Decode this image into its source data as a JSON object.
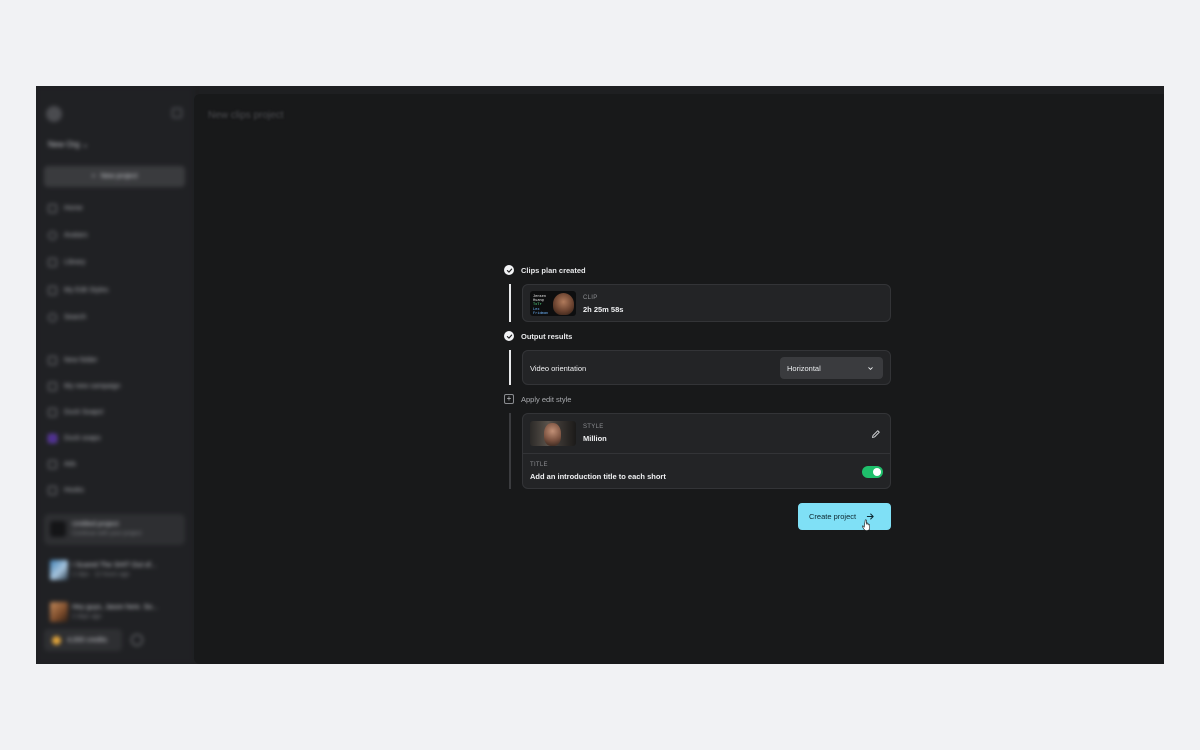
{
  "sidebar": {
    "org_name": "New Org",
    "new_project_label": "New project",
    "nav": [
      {
        "label": "Home",
        "icon": "home-icon"
      },
      {
        "label": "Avatars",
        "icon": "avatar-icon"
      },
      {
        "label": "Library",
        "icon": "library-icon"
      },
      {
        "label": "My Edit Styles",
        "icon": "edit-styles-icon"
      },
      {
        "label": "Search",
        "icon": "search-icon"
      }
    ],
    "folders": [
      {
        "label": "New folder",
        "icon": "folder-icon"
      },
      {
        "label": "My new campaign",
        "icon": "campaign-icon"
      },
      {
        "label": "Duck Soaps!",
        "icon": "campaign-icon"
      },
      {
        "label": "Duck soaps",
        "icon": "campaign-icon"
      },
      {
        "label": "Ads",
        "icon": "folder-icon"
      },
      {
        "label": "Hooks",
        "icon": "folder-icon"
      }
    ],
    "current_project": {
      "title": "Untitled project",
      "subtitle": "Continue with your project"
    },
    "recent_videos": [
      {
        "title": "I Scared The SHIT Out of...",
        "meta": "2 clips · 12 hours ago"
      },
      {
        "title": "Hey guys, Jason here. So...",
        "meta": "2 days ago"
      }
    ],
    "credits": "4,000 credits"
  },
  "main": {
    "header_title": "New clips project",
    "steps": {
      "clips_plan": {
        "title": "Clips plan created",
        "clip_label": "CLIP",
        "clip_duration": "2h 25m 58s",
        "thumb_lines": [
          "Jensen",
          "Huang",
          "TxTr",
          "Lex",
          "Fridman"
        ]
      },
      "output": {
        "title": "Output results",
        "orientation_label": "Video orientation",
        "orientation_value": "Horizontal"
      },
      "edit_style": {
        "title": "Apply edit style",
        "style_label": "STYLE",
        "style_value": "Million",
        "title_label": "TITLE",
        "title_desc": "Add an introduction title to each short",
        "title_enabled": true
      }
    },
    "create_button_label": "Create project"
  },
  "colors": {
    "accent": "#7fe0f6",
    "toggle_on": "#1fbf6b",
    "app_bg": "#18191a",
    "card_bg": "#232426"
  }
}
